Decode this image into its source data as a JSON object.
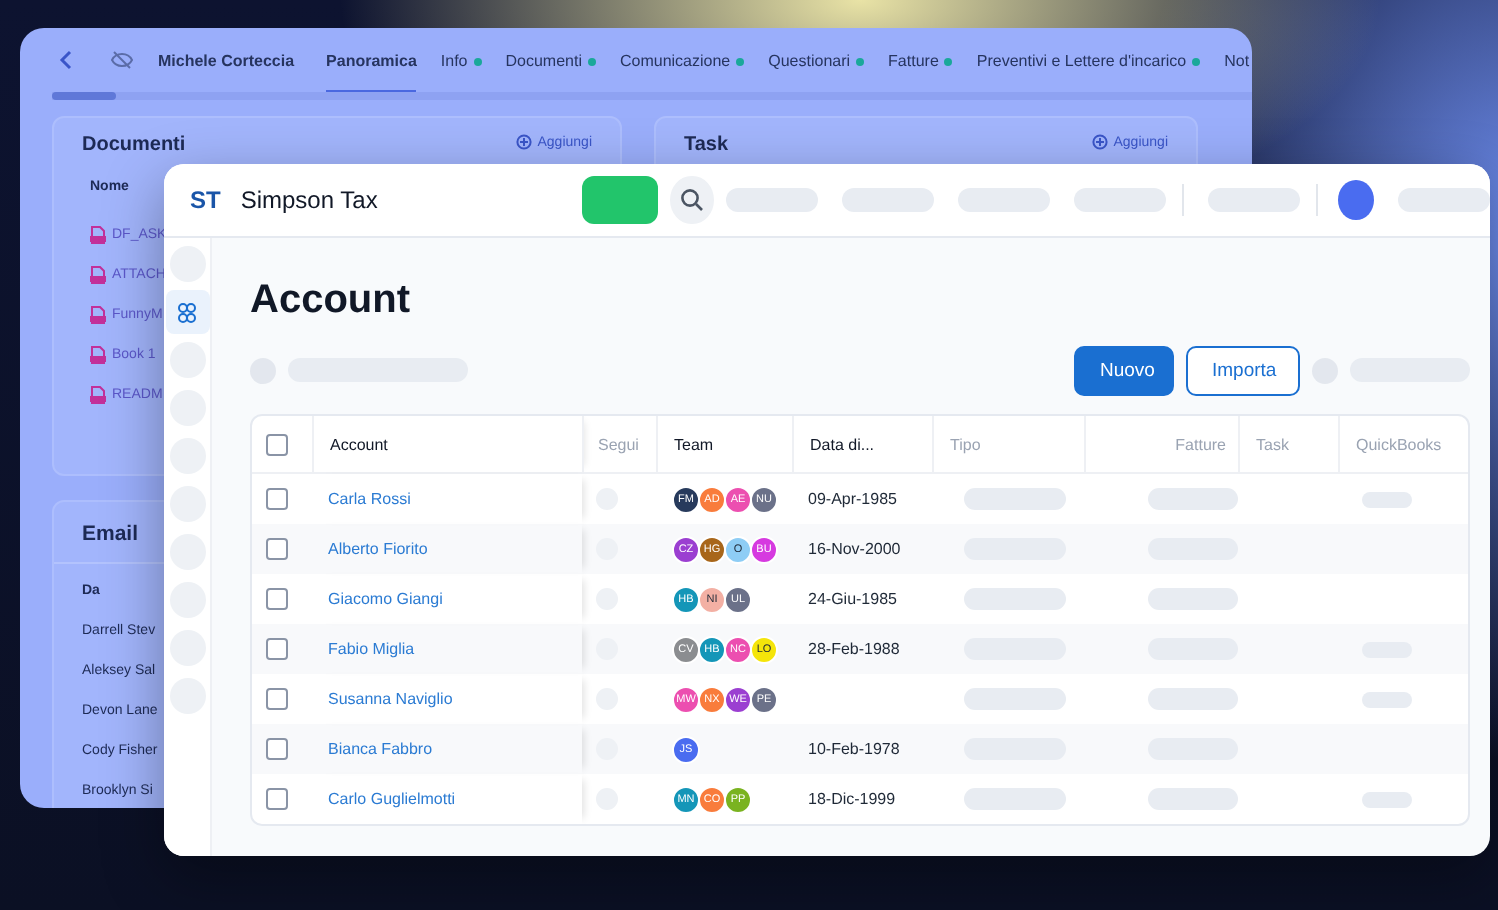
{
  "back_window": {
    "person": "Michele Corteccia",
    "tabs": [
      {
        "label": "Panoramica",
        "selected": true,
        "dot": false
      },
      {
        "label": "Info",
        "selected": false,
        "dot": true
      },
      {
        "label": "Documenti",
        "selected": false,
        "dot": true
      },
      {
        "label": "Comunicazione",
        "selected": false,
        "dot": true
      },
      {
        "label": "Questionari",
        "selected": false,
        "dot": true
      },
      {
        "label": "Fatture",
        "selected": false,
        "dot": true
      },
      {
        "label": "Preventivi e Lettere d'incarico",
        "selected": false,
        "dot": true
      },
      {
        "label": "Not",
        "selected": false,
        "dot": false
      }
    ],
    "documents": {
      "title": "Documenti",
      "add": "Aggiungi",
      "column": "Nome",
      "files": [
        "DF_ASK",
        "ATTACH",
        "FunnyM",
        "Book 1",
        "READM"
      ]
    },
    "task": {
      "title": "Task",
      "add": "Aggiungi"
    },
    "email": {
      "title": "Email",
      "column": "Da",
      "senders": [
        "Darrell Stev",
        "Aleksey Sal",
        "Devon Lane",
        "Cody Fisher",
        "Brooklyn Si"
      ]
    }
  },
  "app": {
    "logo": "ST",
    "name": "Simpson Tax"
  },
  "page": {
    "title": "Account",
    "buttons": [
      {
        "label": "Nuovo",
        "kind": "primary"
      },
      {
        "label": "Importa",
        "kind": "outline"
      }
    ]
  },
  "table": {
    "all_checked": false,
    "columns": [
      "Account",
      "Segui",
      "Team",
      "Data di...",
      "Tipo",
      "Fatture",
      "Task",
      "QuickBooks"
    ],
    "rows": [
      {
        "account": "Carla Rossi",
        "checked": false,
        "date": "09-Apr-1985",
        "quickbooks_bar": true,
        "team": [
          {
            "initials": "FM",
            "color": "#273a5c"
          },
          {
            "initials": "AD",
            "color": "#f97c3c"
          },
          {
            "initials": "AE",
            "color": "#ec4fb0"
          },
          {
            "initials": "NU",
            "color": "#6b7189"
          }
        ]
      },
      {
        "account": "Alberto Fiorito",
        "checked": false,
        "date": "16-Nov-2000",
        "quickbooks_bar": false,
        "team": [
          {
            "initials": "CZ",
            "color": "#9b3fd1"
          },
          {
            "initials": "HG",
            "color": "#a8661a"
          },
          {
            "initials": "O",
            "color": "#8ecdf5"
          },
          {
            "initials": "BU",
            "color": "#d63ae0"
          }
        ]
      },
      {
        "account": "Giacomo Giangi",
        "checked": false,
        "date": "24-Giu-1985",
        "quickbooks_bar": false,
        "team": [
          {
            "initials": "HB",
            "color": "#1496b8"
          },
          {
            "initials": "NI",
            "color": "#f3b0a4"
          },
          {
            "initials": "UL",
            "color": "#6b7189"
          }
        ]
      },
      {
        "account": "Fabio Miglia",
        "checked": false,
        "date": "28-Feb-1988",
        "quickbooks_bar": true,
        "team": [
          {
            "initials": "CV",
            "color": "#8b8d90"
          },
          {
            "initials": "HB",
            "color": "#1496b8"
          },
          {
            "initials": "NC",
            "color": "#ec4fb0"
          },
          {
            "initials": "LO",
            "color": "#f5e50a"
          }
        ]
      },
      {
        "account": "Susanna Naviglio",
        "checked": false,
        "quickbooks_bar": true,
        "team": [
          {
            "initials": "MW",
            "color": "#ec4fb0"
          },
          {
            "initials": "NX",
            "color": "#f97c3c"
          },
          {
            "initials": "WE",
            "color": "#9b3fd1"
          },
          {
            "initials": "PE",
            "color": "#6b7189"
          }
        ]
      },
      {
        "account": "Bianca Fabbro",
        "checked": false,
        "date": "10-Feb-1978",
        "quickbooks_bar": false,
        "team": [
          {
            "initials": "JS",
            "color": "#4a6cf0"
          }
        ]
      },
      {
        "account": "Carlo Guglielmotti",
        "checked": false,
        "date": "18-Dic-1999",
        "quickbooks_bar": true,
        "team": [
          {
            "initials": "MN",
            "color": "#1496b8"
          },
          {
            "initials": "CO",
            "color": "#f97c3c"
          },
          {
            "initials": "PP",
            "color": "#7ab320"
          }
        ]
      }
    ]
  }
}
